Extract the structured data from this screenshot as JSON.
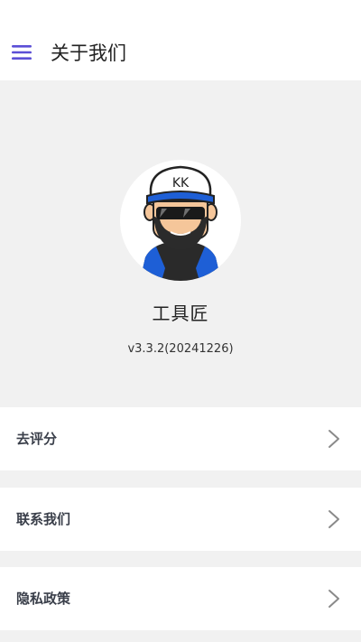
{
  "header": {
    "title": "关于我们",
    "menu_icon": "hamburger-menu-icon",
    "accent_color": "#5b4fd6"
  },
  "about": {
    "app_name": "工具匠",
    "version": "v3.3.2(20241226)",
    "logo_text": "KK"
  },
  "menu": [
    {
      "label": "去评分",
      "icon": "chevron-right-icon"
    },
    {
      "label": "联系我们",
      "icon": "chevron-right-icon"
    },
    {
      "label": "隐私政策",
      "icon": "chevron-right-icon"
    }
  ]
}
